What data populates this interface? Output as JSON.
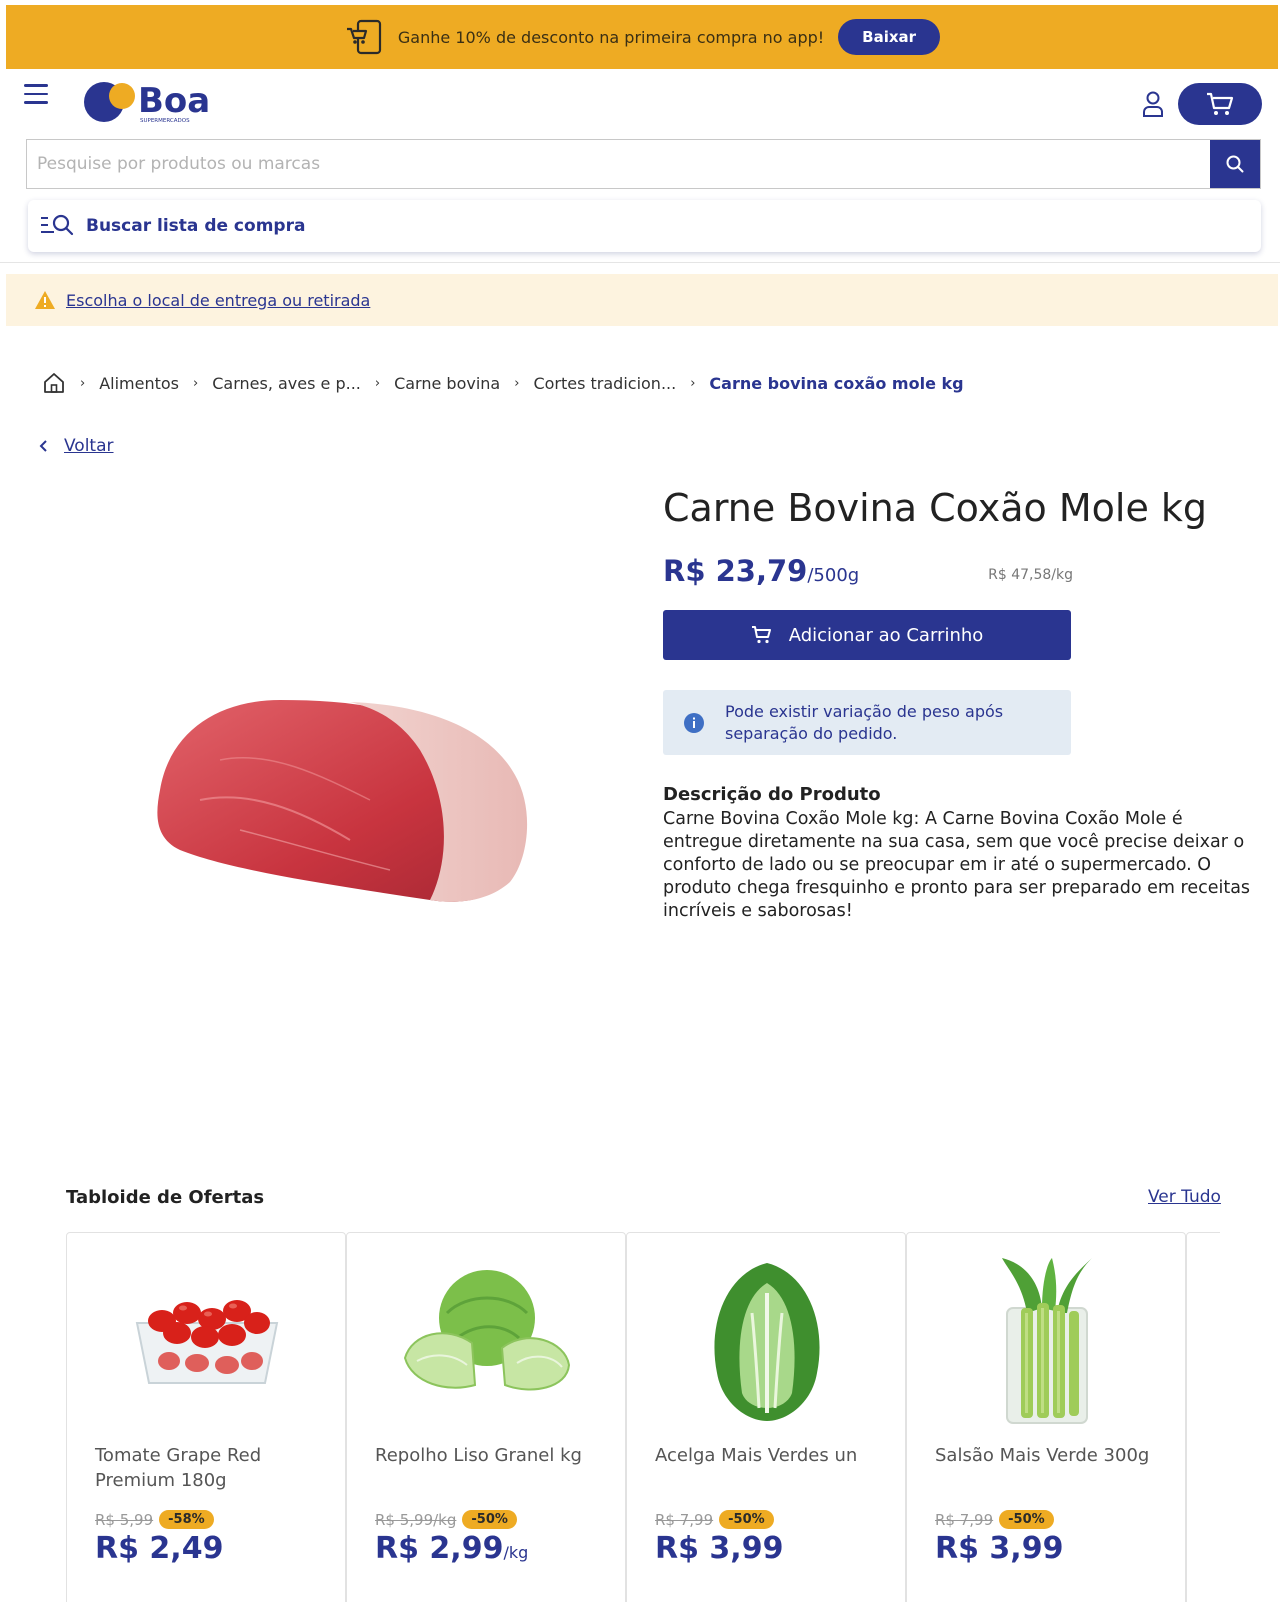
{
  "promo": {
    "text": "Ganhe 10% de desconto na primeira compra no app!",
    "button": "Baixar"
  },
  "header": {
    "logo_text": "Boa",
    "logo_subtext": "SUPERMERCADOS"
  },
  "search": {
    "placeholder": "Pesquise por produtos ou marcas"
  },
  "list_search": {
    "label": "Buscar lista de compra"
  },
  "location": {
    "label": "Escolha o local de entrega ou retirada"
  },
  "breadcrumb": {
    "items": [
      "Alimentos",
      "Carnes, aves e p...",
      "Carne bovina",
      "Cortes tradicion..."
    ],
    "current": "Carne bovina coxão mole kg"
  },
  "back": {
    "label": "Voltar"
  },
  "product": {
    "title": "Carne Bovina Coxão Mole kg",
    "price": "R$ 23,79",
    "price_unit": "/500g",
    "price_per_kg": "R$ 47,58/kg",
    "add_to_cart": "Adicionar ao Carrinho",
    "weight_notice": "Pode existir variação de peso após separação do pedido.",
    "description_title": "Descrição do Produto",
    "description": "Carne Bovina Coxão Mole kg: A Carne Bovina Coxão Mole é entregue diretamente na sua casa, sem que você precise deixar o conforto de lado ou se preocupar em ir até o supermercado. O produto chega fresquinho e pronto para ser preparado em receitas incríveis e saborosas!"
  },
  "offers": {
    "title": "Tabloide de Ofertas",
    "see_all": "Ver Tudo",
    "items": [
      {
        "name": "Tomate Grape Red Premium 180g",
        "old_price": "R$ 5,99",
        "discount": "-58%",
        "price": "R$ 2,49",
        "unit": "",
        "image": "tomato"
      },
      {
        "name": "Repolho Liso Granel kg",
        "old_price": "R$ 5,99/kg",
        "discount": "-50%",
        "price": "R$ 2,99",
        "unit": "/kg",
        "image": "cabbage"
      },
      {
        "name": "Acelga Mais Verdes un",
        "old_price": "R$ 7,99",
        "discount": "-50%",
        "price": "R$ 3,99",
        "unit": "",
        "image": "chard"
      },
      {
        "name": "Salsão Mais Verde 300g",
        "old_price": "R$ 7,99",
        "discount": "-50%",
        "price": "R$ 3,99",
        "unit": "",
        "image": "celery"
      }
    ]
  },
  "colors": {
    "brand_blue": "#2a3590",
    "promo_yellow": "#eeab23",
    "location_bg": "#fdf3df",
    "info_bg": "#e3ebf3"
  }
}
